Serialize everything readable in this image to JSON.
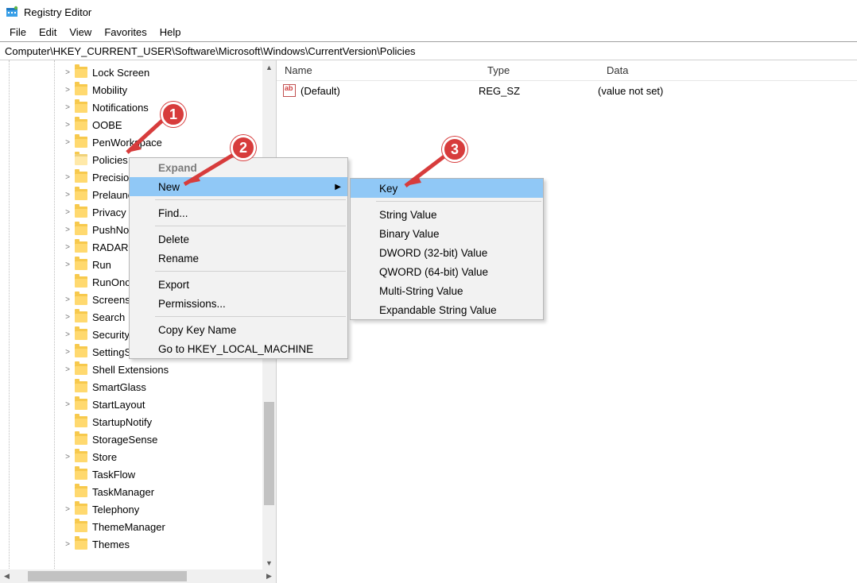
{
  "title": "Registry Editor",
  "menubar": [
    "File",
    "Edit",
    "View",
    "Favorites",
    "Help"
  ],
  "address": "Computer\\HKEY_CURRENT_USER\\Software\\Microsoft\\Windows\\CurrentVersion\\Policies",
  "tree": [
    {
      "label": "Lock Screen",
      "chev": true
    },
    {
      "label": "Mobility",
      "chev": true
    },
    {
      "label": "Notifications",
      "chev": true
    },
    {
      "label": "OOBE",
      "chev": true
    },
    {
      "label": "PenWorkspace",
      "chev": true
    },
    {
      "label": "Policies",
      "chev": false,
      "selected": true
    },
    {
      "label": "PrecisionTouchPad",
      "chev": true
    },
    {
      "label": "Prelaunch",
      "chev": true
    },
    {
      "label": "Privacy",
      "chev": true
    },
    {
      "label": "PushNotifications",
      "chev": true
    },
    {
      "label": "RADAR",
      "chev": true
    },
    {
      "label": "Run",
      "chev": true
    },
    {
      "label": "RunOnce",
      "chev": false
    },
    {
      "label": "Screensavers",
      "chev": true
    },
    {
      "label": "Search",
      "chev": true
    },
    {
      "label": "Security and Maintenance",
      "chev": true
    },
    {
      "label": "SettingSync",
      "chev": true
    },
    {
      "label": "Shell Extensions",
      "chev": true
    },
    {
      "label": "SmartGlass",
      "chev": false
    },
    {
      "label": "StartLayout",
      "chev": true
    },
    {
      "label": "StartupNotify",
      "chev": false
    },
    {
      "label": "StorageSense",
      "chev": false
    },
    {
      "label": "Store",
      "chev": true
    },
    {
      "label": "TaskFlow",
      "chev": false
    },
    {
      "label": "TaskManager",
      "chev": false
    },
    {
      "label": "Telephony",
      "chev": true
    },
    {
      "label": "ThemeManager",
      "chev": false
    },
    {
      "label": "Themes",
      "chev": true
    }
  ],
  "columns": {
    "name": "Name",
    "type": "Type",
    "data": "Data"
  },
  "values": [
    {
      "name": "(Default)",
      "type": "REG_SZ",
      "data": "(value not set)"
    }
  ],
  "context_menu": {
    "items": [
      {
        "label": "Expand",
        "disabled": true,
        "bold": true
      },
      {
        "label": "New",
        "highlight": true,
        "submenu": true
      },
      {
        "sep": true
      },
      {
        "label": "Find..."
      },
      {
        "sep": true
      },
      {
        "label": "Delete"
      },
      {
        "label": "Rename"
      },
      {
        "sep": true
      },
      {
        "label": "Export"
      },
      {
        "label": "Permissions..."
      },
      {
        "sep": true
      },
      {
        "label": "Copy Key Name"
      },
      {
        "label": "Go to HKEY_LOCAL_MACHINE"
      }
    ],
    "submenu": [
      {
        "label": "Key",
        "highlight": true
      },
      {
        "sep": true
      },
      {
        "label": "String Value"
      },
      {
        "label": "Binary Value"
      },
      {
        "label": "DWORD (32-bit) Value"
      },
      {
        "label": "QWORD (64-bit) Value"
      },
      {
        "label": "Multi-String Value"
      },
      {
        "label": "Expandable String Value"
      }
    ]
  },
  "badges": {
    "b1": "1",
    "b2": "2",
    "b3": "3"
  }
}
